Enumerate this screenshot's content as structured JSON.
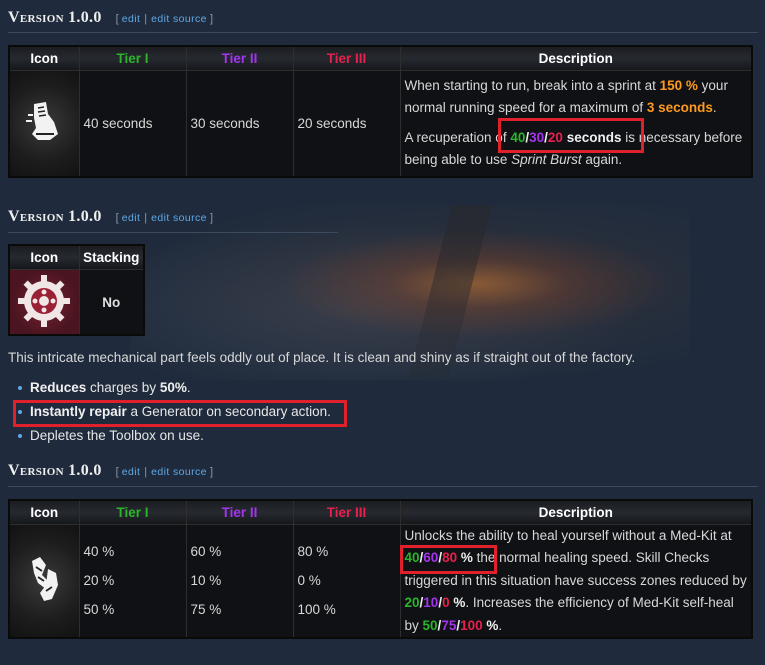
{
  "sections": [
    {
      "version_title": "Version 1.0.0",
      "edit_label": "edit",
      "edit_source_label": "edit source",
      "headers": {
        "icon": "Icon",
        "tier1": "Tier I",
        "tier2": "Tier II",
        "tier3": "Tier III",
        "description": "Description"
      },
      "tiers": [
        "40 seconds",
        "30 seconds",
        "20 seconds"
      ],
      "icon_name": "sprint-burst-icon",
      "description": {
        "p1_a": "When starting to run, break into a sprint at ",
        "p1_pct": "150 %",
        "p1_b": " your normal running speed for a maximum of ",
        "p1_secs": "3 seconds",
        "p1_c": ".",
        "p2_a": "A recuperation of ",
        "p2_v1": "40",
        "p2_v2": "30",
        "p2_v3": "20",
        "p2_unit": " seconds",
        "p2_b": " is necessary before being able to use ",
        "p2_perk": "Sprint Burst",
        "p2_c": " again."
      }
    },
    {
      "version_title": "Version 1.0.0",
      "edit_label": "edit",
      "edit_source_label": "edit source",
      "headers": {
        "icon": "Icon",
        "stacking": "Stacking"
      },
      "stacking_value": "No",
      "icon_name": "gear-icon",
      "flavor": "This intricate mechanical part feels oddly out of place. It is clean and shiny as if straight out of the factory.",
      "bullets": [
        {
          "bold": "Reduces",
          "rest": " charges by ",
          "bold2": "50%",
          "rest2": "."
        },
        {
          "bold": "Instantly repair",
          "rest": " a Generator on secondary action.",
          "bold2": "",
          "rest2": ""
        },
        {
          "bold": "",
          "rest": "Depletes the Toolbox on use.",
          "bold2": "",
          "rest2": ""
        }
      ]
    },
    {
      "version_title": "Version 1.0.0",
      "edit_label": "edit",
      "edit_source_label": "edit source",
      "headers": {
        "icon": "Icon",
        "tier1": "Tier I",
        "tier2": "Tier II",
        "tier3": "Tier III",
        "description": "Description"
      },
      "icon_name": "self-care-icon",
      "rows": [
        [
          "40 %",
          "60 %",
          "80 %"
        ],
        [
          "20 %",
          "10 %",
          "0 %"
        ],
        [
          "50 %",
          "75 %",
          "100 %"
        ]
      ],
      "description": {
        "a": "Unlocks the ability to heal yourself without a Med-Kit at ",
        "v1": "40",
        "v2": "60",
        "v3": "80",
        "unit": " %",
        "b": " the normal healing speed. Skill Checks triggered in this situation have success zones reduced by ",
        "w1": "20",
        "w2": "10",
        "w3": "0",
        "unit2": " %",
        "c": ". Increases the efficiency of Med-Kit self-heal by ",
        "x1": "50",
        "x2": "75",
        "x3": "100",
        "unit3": " %",
        "d": "."
      }
    }
  ],
  "colors": {
    "tier1": "#2bb52b",
    "tier2": "#a335ee",
    "tier3": "#e8204e",
    "highlight": "#e0202a",
    "accent": "#ff9a1f"
  }
}
